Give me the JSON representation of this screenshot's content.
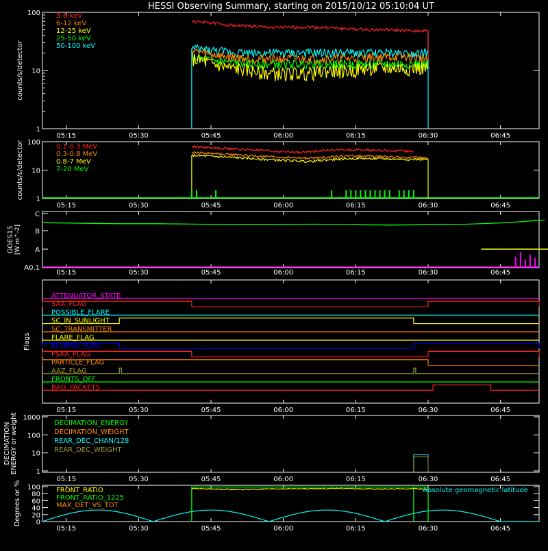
{
  "title": "HESSI Observing Summary, starting on 2015/10/12 05:10:04 UT",
  "time_ticks": [
    "05:15",
    "05:30",
    "05:45",
    "06:00",
    "06:15",
    "06:30",
    "06:45"
  ],
  "colors": {
    "red": "#ff2020",
    "orange": "#ff8800",
    "yellow": "#ffff00",
    "green": "#00ff00",
    "cyan": "#00ffff",
    "magenta": "#ff00ff",
    "blue": "#0000ff",
    "olive": "#a0a030",
    "brown": "#d06000",
    "white": "#ffffff"
  },
  "chart_data": [
    {
      "type": "line",
      "panel": "hessi_rates",
      "ylabel": "counts/s/detector",
      "y_scale": "log",
      "ylim": [
        1,
        100
      ],
      "yticks": [
        "1",
        "10",
        "100"
      ],
      "x_range": [
        "05:10:04",
        "06:53"
      ],
      "series": [
        {
          "name": "3-6 keV",
          "color": "#ff2020",
          "start": "05:41",
          "end": "06:30",
          "values": [
            70,
            66,
            60,
            58,
            55,
            55,
            56,
            54,
            52,
            50,
            50,
            48,
            48
          ]
        },
        {
          "name": "6-12 keV",
          "color": "#ff8800",
          "start": "05:41",
          "end": "06:30",
          "values": [
            22,
            19,
            17,
            16,
            16,
            16,
            16,
            16,
            16,
            17,
            17,
            17,
            16
          ]
        },
        {
          "name": "12-25 keV",
          "color": "#ffff00",
          "start": "05:41",
          "end": "06:30",
          "values": [
            16,
            13,
            11,
            10,
            9,
            9,
            9,
            10,
            10,
            11,
            11,
            11,
            11
          ]
        },
        {
          "name": "25-50 keV",
          "color": "#00ff00",
          "start": "05:41",
          "end": "06:30",
          "values": [
            17,
            15,
            14,
            13,
            13,
            13,
            13,
            13,
            13,
            13,
            13,
            13,
            13
          ]
        },
        {
          "name": "50-100 keV",
          "color": "#00ffff",
          "start": "05:41",
          "end": "06:30",
          "values": [
            24,
            22,
            21,
            20,
            20,
            20,
            20,
            20,
            20,
            20,
            20,
            20,
            20
          ]
        }
      ]
    },
    {
      "type": "line",
      "panel": "high_energy_rates",
      "ylabel": "counts/s/detector",
      "y_scale": "log",
      "ylim": [
        1,
        100
      ],
      "yticks": [
        "1",
        "10",
        "100"
      ],
      "series": [
        {
          "name": "0.1-0.3 MeV",
          "color": "#ff2020",
          "start": "05:41",
          "end": "06:27",
          "values": [
            68,
            60,
            55,
            50,
            45,
            42,
            50,
            52,
            50,
            48,
            46
          ]
        },
        {
          "name": "0.3-0.8 MeV",
          "color": "#ff8800",
          "start": "05:41",
          "end": "06:30",
          "values": [
            42,
            38,
            34,
            30,
            28,
            26,
            30,
            32,
            30,
            28,
            27
          ]
        },
        {
          "name": "0.8-7 MeV",
          "color": "#ffff00",
          "start": "05:41",
          "end": "06:30",
          "values": [
            33,
            30,
            27,
            24,
            22,
            20,
            24,
            26,
            25,
            24,
            24
          ]
        },
        {
          "name": "7-20 MeV",
          "color": "#00ff00",
          "spikes": [
            "05:41",
            "05:42",
            "05:46",
            "06:10",
            "06:13",
            "06:14",
            "06:15",
            "06:16",
            "06:17",
            "06:18",
            "06:19",
            "06:20",
            "06:21",
            "06:22",
            "06:24",
            "06:25",
            "06:26",
            "06:27"
          ]
        }
      ]
    },
    {
      "type": "line",
      "panel": "goes",
      "ylabel": "GOES15",
      "ylabel2": "[W m^-2]",
      "yticks": [
        "A0.1",
        "A",
        "B",
        "C"
      ],
      "series": [
        {
          "name": "goes_long",
          "color": "#00ff00",
          "values": [
            0.92,
            0.91,
            0.9,
            0.9,
            0.89,
            0.88,
            0.88,
            0.89,
            0.88,
            0.87,
            0.88,
            0.89,
            0.92,
            0.98
          ]
        },
        {
          "name": "goes_short",
          "color": "#ffff00",
          "start": "06:41",
          "level": "A"
        }
      ]
    },
    {
      "type": "flags",
      "panel": "flags",
      "ylabel": "Flags",
      "flags": [
        {
          "name": "ATTENUATOR_STATE",
          "color": "#ff00ff",
          "high": []
        },
        {
          "name": "SAA_FLAG",
          "color": "#ff2020",
          "high": [
            [
              "05:10",
              "05:41"
            ],
            [
              "06:30",
              "06:53"
            ]
          ]
        },
        {
          "name": "POSSIBLE_FLARE",
          "color": "#00ffff",
          "high": []
        },
        {
          "name": "SC_IN_SUNLIGHT",
          "color": "#ffff00",
          "high": [
            [
              "05:26",
              "06:27"
            ]
          ]
        },
        {
          "name": "SC_TRANSMITTER",
          "color": "#ff8800",
          "high": []
        },
        {
          "name": "FLARE_FLAG",
          "color": "#ffff00",
          "high": []
        },
        {
          "name": "ECLIPSE_FLAG",
          "color": "#0000ff",
          "high": [
            [
              "05:10",
              "05:26"
            ],
            [
              "06:27",
              "06:53"
            ]
          ]
        },
        {
          "name": "FSAA_FLAG",
          "color": "#ff2020",
          "high": [
            [
              "05:10",
              "05:41"
            ],
            [
              "06:30",
              "06:53"
            ]
          ]
        },
        {
          "name": "PARTICLE_FLAG",
          "color": "#ff8800",
          "high": [
            [
              "05:10",
              "06:30"
            ]
          ]
        },
        {
          "name": "AAZ_FLAG",
          "color": "#a0a030",
          "high": [
            [
              "05:26",
              "05:26"
            ],
            [
              "06:27",
              "06:27"
            ]
          ]
        },
        {
          "name": "FRONTS_OFF",
          "color": "#00ff00",
          "high": []
        },
        {
          "name": "BAD_PACKETS",
          "color": "#ff2020",
          "high": [
            [
              "06:31",
              "06:43"
            ]
          ]
        }
      ]
    },
    {
      "type": "line",
      "panel": "decimation",
      "ylabel": "DECIMATION",
      "ylabel2": "ENERGY or weight",
      "y_scale": "log",
      "ylim": [
        1,
        1000
      ],
      "yticks": [
        "1",
        "10",
        "100",
        "1000"
      ],
      "series": [
        {
          "name": "DECIMATION_ENERGY",
          "color": "#00ff00",
          "values": []
        },
        {
          "name": "DECIMATION_WEIGHT",
          "color": "#ff8800",
          "values": []
        },
        {
          "name": "REAR_DEC_CHAN/128",
          "color": "#00ffff",
          "start": "06:27",
          "end": "06:30",
          "level": 8
        },
        {
          "name": "REAR_DEC_WEIGHT",
          "color": "#a0a030",
          "start": "06:27",
          "end": "06:30",
          "level": 6
        }
      ]
    },
    {
      "type": "line",
      "panel": "ratios",
      "ylabel": "Degrees or %",
      "ylim": [
        0,
        100
      ],
      "yticks": [
        "0",
        "20",
        "40",
        "60",
        "80",
        "100"
      ],
      "annotation": "Absolute geomagnetic latitude",
      "series": [
        {
          "name": "FRONT_RATIO",
          "color": "#ffff00",
          "start": "05:41",
          "end": "06:30",
          "values": [
            95,
            93,
            92,
            93,
            94,
            94,
            95,
            94,
            93,
            94,
            93
          ]
        },
        {
          "name": "FRONT_RATIO_1225",
          "color": "#00ff00",
          "start": "05:41",
          "end": "06:30",
          "values": [
            99,
            99,
            99,
            99,
            99,
            99,
            99,
            99,
            99,
            99,
            99
          ]
        },
        {
          "name": "MAX_DET_VS_TOT",
          "color": "#ff8800",
          "values": []
        },
        {
          "name": "Absolute geomagnetic latitude",
          "color": "#00ffff",
          "peaks": [
            "05:10",
            "05:33",
            "05:57",
            "06:21",
            "06:45"
          ],
          "peak_value": 33
        }
      ]
    }
  ]
}
